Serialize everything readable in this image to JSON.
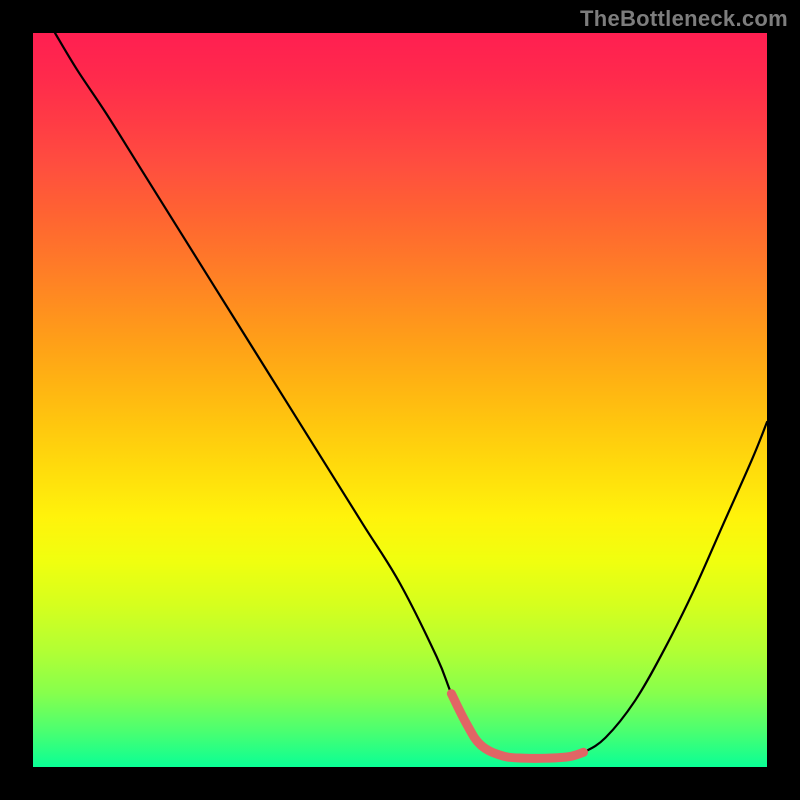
{
  "watermark": "TheBottleneck.com",
  "colors": {
    "page_bg": "#000000",
    "curve_stroke": "#000000",
    "highlight_stroke": "#e16565",
    "gradient_top": "#ff1f51",
    "gradient_bottom": "#0aff95",
    "watermark_text": "#7d7d7d"
  },
  "chart_data": {
    "type": "line",
    "title": "",
    "xlabel": "",
    "ylabel": "",
    "xlim": [
      0,
      100
    ],
    "ylim": [
      0,
      100
    ],
    "grid": false,
    "legend": false,
    "annotations": [],
    "series": [
      {
        "name": "curve",
        "x": [
          3,
          6,
          10,
          15,
          20,
          25,
          30,
          35,
          40,
          45,
          50,
          55,
          57,
          59,
          61,
          64,
          67,
          70,
          73,
          75,
          78,
          82,
          86,
          90,
          94,
          98,
          100
        ],
        "y": [
          100,
          95,
          89,
          81,
          73,
          65,
          57,
          49,
          41,
          33,
          25,
          15,
          10,
          6,
          3,
          1.5,
          1.2,
          1.2,
          1.4,
          2,
          4,
          9,
          16,
          24,
          33,
          42,
          47
        ]
      },
      {
        "name": "highlight-band",
        "x": [
          57,
          59,
          61,
          64,
          67,
          70,
          73,
          75
        ],
        "y": [
          10,
          6,
          3,
          1.5,
          1.2,
          1.2,
          1.4,
          2
        ]
      }
    ]
  }
}
